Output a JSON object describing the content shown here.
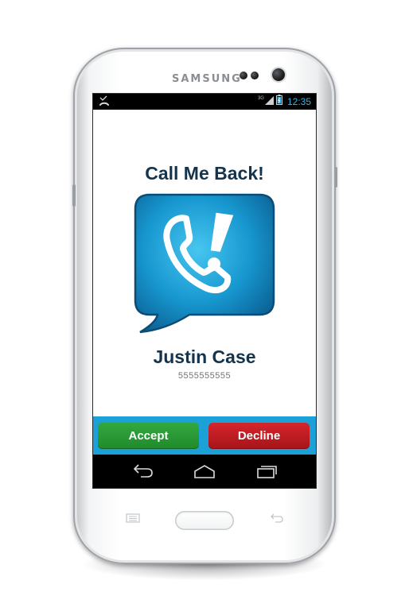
{
  "device": {
    "brand": "SAMSUNG",
    "color": "#ffffff"
  },
  "status_bar": {
    "left_icon": "missed-call-icon",
    "network": "3G",
    "signal_icon": "signal-icon",
    "battery_icon": "battery-icon",
    "time": "12:35"
  },
  "main": {
    "title": "Call Me Back!",
    "logo_icon": "phone-callback-icon",
    "contact_name": "Justin Case",
    "contact_number": "5555555555"
  },
  "actions": {
    "accept_label": "Accept",
    "decline_label": "Decline",
    "accept_color": "#2c9f38",
    "decline_color": "#c51d23",
    "bar_color": "#1ba0d7"
  },
  "nav_bar": {
    "back_icon": "back-icon",
    "home_icon": "home-icon",
    "recents_icon": "recents-icon"
  },
  "hardware_keys": {
    "menu_icon": "menu-icon",
    "home_key": "home-key",
    "back_icon": "back-icon"
  },
  "colors": {
    "title_text": "#14344d",
    "accent_blue": "#1ba0d7",
    "status_time": "#33b5e5"
  }
}
